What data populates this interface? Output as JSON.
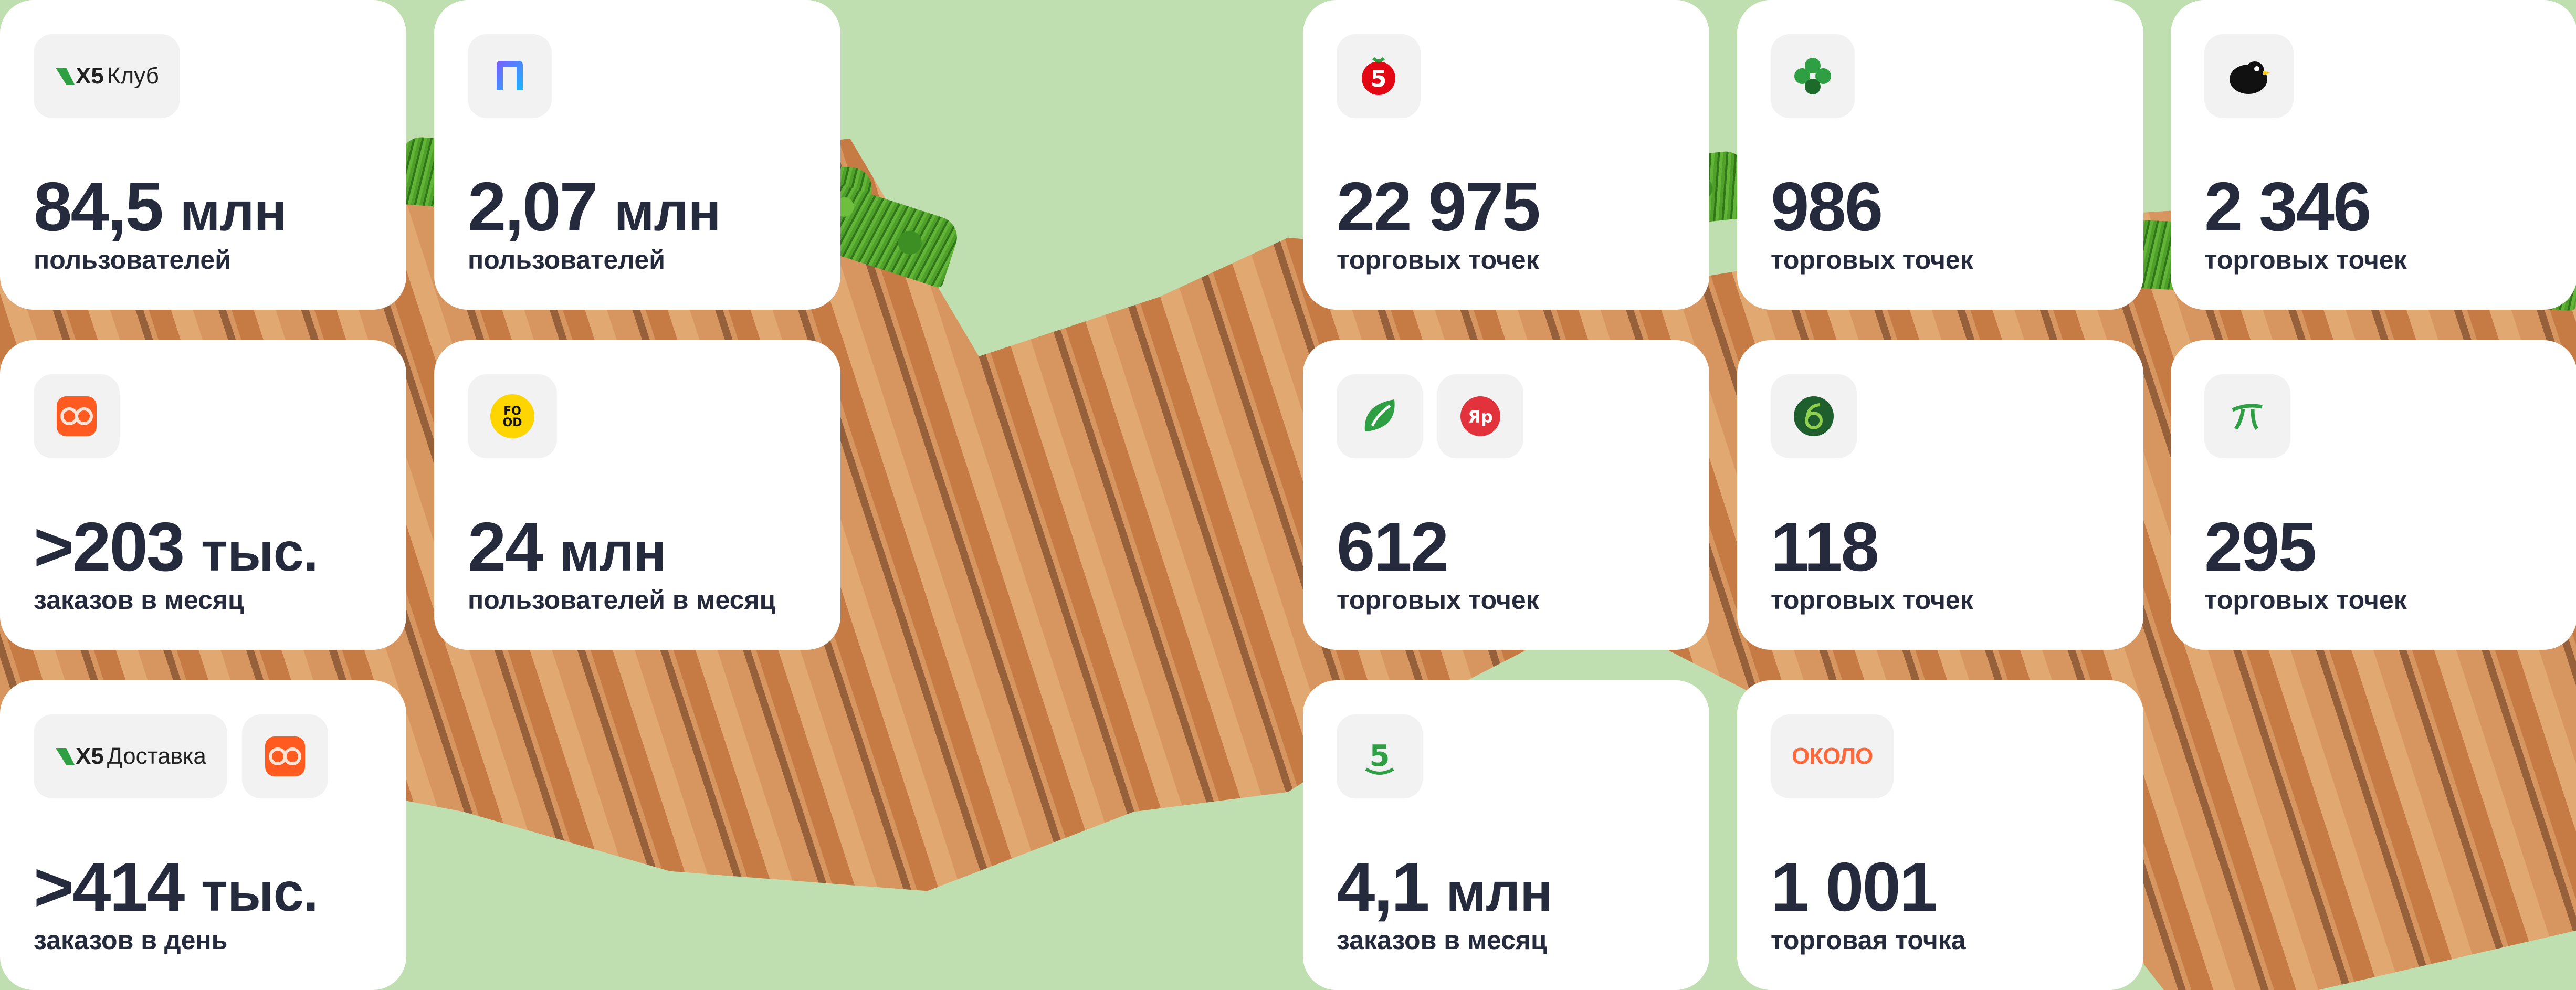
{
  "cards": [
    {
      "logos": [
        "X5 Клуб"
      ],
      "value": "84,5",
      "unit": "млн",
      "label": "пользователей"
    },
    {
      "logos": [
        "Пятёрочка Плюс"
      ],
      "value": "2,07",
      "unit": "млн",
      "label": "пользователей"
    },
    {
      "logos": [
        "Пятёрочка"
      ],
      "value": "22 975",
      "unit": "",
      "label": "торговых точек"
    },
    {
      "logos": [
        "Перекрёсток"
      ],
      "value": "986",
      "unit": "",
      "label": "торговых точек"
    },
    {
      "logos": [
        "Чижик"
      ],
      "value": "2 346",
      "unit": "",
      "label": "торговых точек"
    },
    {
      "logos": [
        "Много Лосося"
      ],
      "value": ">203",
      "unit": "тыс.",
      "label": "заказов в месяц"
    },
    {
      "logos": [
        "Food.ru"
      ],
      "value": "24",
      "unit": "млн",
      "label": "пользователей в месяц"
    },
    {
      "logos": [
        "Перекрёсток Впрок",
        "Ярче"
      ],
      "value": "612",
      "unit": "",
      "label": "торговых точек"
    },
    {
      "logos": [
        "Карусель"
      ],
      "value": "118",
      "unit": "",
      "label": "торговых точек"
    },
    {
      "logos": [
        "Пятёрочка Выручай"
      ],
      "value": "295",
      "unit": "",
      "label": "торговых точек"
    },
    {
      "logos": [
        "X5 Доставка",
        "Много Лосося"
      ],
      "value": ">414",
      "unit": "тыс.",
      "label": "заказов в день"
    },
    {
      "logos": [
        "Пятёрочка Доставка"
      ],
      "value": "4,1",
      "unit": "млн",
      "label": "заказов в месяц"
    },
    {
      "logos": [
        "Около"
      ],
      "value": "1 001",
      "unit": "",
      "label": "торговая точка"
    }
  ],
  "logo_text": {
    "x5club": "Клуб",
    "x5delivery": "Доставка",
    "x5": "X5",
    "food": "FO OD",
    "yarche": "Яр",
    "okolo": "ОКОЛО"
  },
  "colors": {
    "background": "#bfdfb1",
    "card": "#ffffff",
    "text": "#252b3d",
    "pyaterochka_red": "#e30613",
    "green": "#2ea043",
    "orange": "#ff5a1f",
    "food_yellow": "#ffd500",
    "okolo_orange": "#ff6a3d"
  }
}
